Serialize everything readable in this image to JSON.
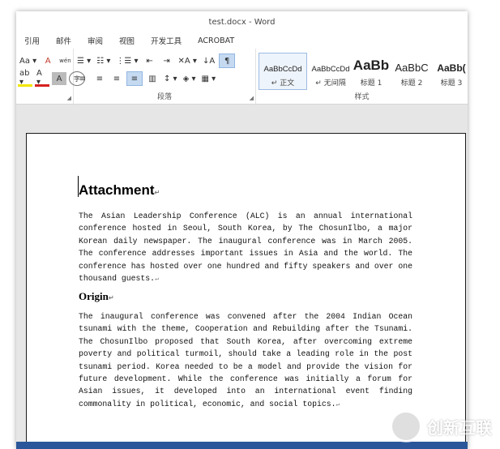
{
  "window": {
    "title": "test.docx - Word"
  },
  "tabs": [
    "引用",
    "邮件",
    "审阅",
    "视图",
    "开发工具",
    "ACROBAT"
  ],
  "ribbon": {
    "font_group": {
      "row1": [
        "Aa ▾",
        "A",
        "wén"
      ],
      "row2": [
        "ab ▾",
        "A ▾",
        "A",
        "字"
      ]
    },
    "paragraph_group": {
      "label": "段落",
      "row1": [
        "☰ ▾",
        "☷ ▾",
        "⋮☰ ▾",
        "⇤",
        "⇥",
        "✕A ▾",
        "↓A",
        "¶"
      ],
      "row2": [
        "≡",
        "≡",
        "≡",
        "≡",
        "▥",
        "↕ ▾",
        "◈ ▾",
        "▦ ▾"
      ]
    },
    "styles_group": {
      "label": "样式",
      "items": [
        {
          "sample": "AaBbCcDd",
          "name": "↵ 正文",
          "selected": true
        },
        {
          "sample": "AaBbCcDd",
          "name": "↵ 无间隔",
          "selected": false
        },
        {
          "sample": "AaBb",
          "name": "标题 1",
          "selected": false
        },
        {
          "sample": "AaBbC",
          "name": "标题 2",
          "selected": false
        },
        {
          "sample": "AaBb(",
          "name": "标题 3",
          "selected": false
        }
      ]
    }
  },
  "document": {
    "title": "Attachment",
    "paragraph1": "The Asian Leadership Conference (ALC) is an annual international conference hosted in Seoul, South Korea, by The ChosunIlbo, a major Korean daily newspaper. The inaugural conference was in March 2005. The conference addresses important issues in Asia and the world. The conference has hosted over one hundred and fifty speakers and over one thousand guests.",
    "heading2": "Origin",
    "paragraph2": "The inaugural conference was convened after the 2004 Indian Ocean tsunami with the theme, Cooperation and Rebuilding after the Tsunami. The ChosunIlbo proposed that South Korea, after overcoming extreme poverty and political turmoil, should take a leading role in the post tsunami period. Korea needed to be a model and provide the vision for future development. While the conference was initially a forum for Asian issues, it developed into an international event finding commonality in political, economic, and social topics."
  },
  "watermark": {
    "text": "创新互联"
  },
  "colors": {
    "accent": "#2b579a"
  }
}
